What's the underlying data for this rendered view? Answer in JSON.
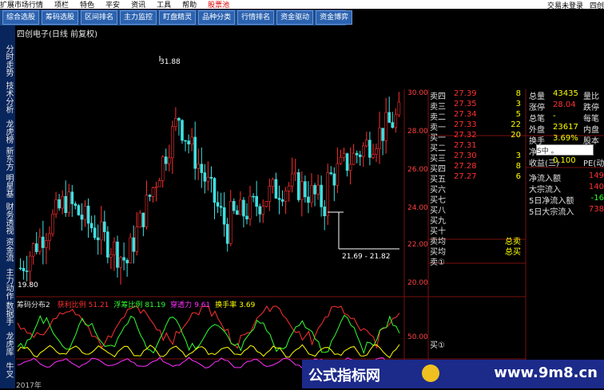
{
  "menubar": {
    "items": [
      "扩展市场行情",
      "项栏",
      "特色",
      "平安",
      "资讯",
      "工具",
      "帮助"
    ],
    "stock_pool": "股票池",
    "right": [
      "交易未登录",
      "四创"
    ]
  },
  "tabs": [
    "综合选股",
    "筹码选股",
    "区间排名",
    "主力监控",
    "盯盘精灵",
    "品种分类",
    "行情排名",
    "资金驱动",
    "资金博弈"
  ],
  "sidebar": [
    "分时走势",
    "技术分析",
    "龙虎榜",
    "新东方",
    "明星基",
    "财务透视",
    "资金流",
    "主力动作",
    "数据手",
    "龙虎库",
    "牛叉"
  ],
  "chart": {
    "title": "四创电子(日线 前复权)",
    "high_marker": "31.88",
    "low_marker": "19.80",
    "range_label": "21.69 - 21.82",
    "y_ticks": [
      "30.00",
      "28.00",
      "26.00",
      "24.00",
      "22.00",
      "20.00"
    ]
  },
  "order_book": [
    {
      "label": "卖四",
      "price": "27.39",
      "vol": "8"
    },
    {
      "label": "卖三",
      "price": "27.35",
      "vol": "3"
    },
    {
      "label": "卖二",
      "price": "27.34",
      "vol": "5"
    },
    {
      "label": "卖一",
      "price": "27.33",
      "vol": "22"
    },
    {
      "label": "买一",
      "price": "27.32",
      "vol": "20"
    },
    {
      "label": "买二",
      "price": "27.31",
      "vol": ""
    },
    {
      "label": "买三",
      "price": "27.30",
      "vol": "3"
    },
    {
      "label": "买四",
      "price": "27.28",
      "vol": "8"
    },
    {
      "label": "买五",
      "price": "27.27",
      "vol": "6"
    },
    {
      "label": "买六",
      "price": "",
      "vol": ""
    },
    {
      "label": "买七",
      "price": "",
      "vol": ""
    },
    {
      "label": "买八",
      "price": "",
      "vol": ""
    },
    {
      "label": "买九",
      "price": "",
      "vol": ""
    },
    {
      "label": "买十",
      "price": "",
      "vol": ""
    },
    {
      "label": "卖均",
      "price": "",
      "vol": "总卖"
    },
    {
      "label": "买均",
      "price": "",
      "vol": "总买"
    },
    {
      "label": "卖①",
      "price": "",
      "vol": ""
    }
  ],
  "stats": [
    {
      "k": "总量",
      "v": "43435",
      "x": "量比"
    },
    {
      "k": "涨停",
      "v": "28.04",
      "x": "跌停"
    },
    {
      "k": "总笔",
      "v": "-",
      "x": "每笔"
    },
    {
      "k": "外盘",
      "v": "23617",
      "x": "内盘"
    },
    {
      "k": "换手",
      "v": "3.69%",
      "x": "股本"
    },
    {
      "k": "净",
      "v": "",
      "x": ""
    },
    {
      "k": "收益(三)",
      "v": "0.100",
      "x": "PE(动"
    }
  ],
  "flows": [
    {
      "k": "净流入额",
      "v": "149"
    },
    {
      "k": "大宗流入",
      "v": "140"
    },
    {
      "k": "5日净流入额",
      "v": "-16"
    },
    {
      "k": "5日大宗流入",
      "v": "738"
    }
  ],
  "indicator": {
    "name": "筹码分布2",
    "items": [
      {
        "k": "获利比例",
        "v": "51.21",
        "color": "#ff3030"
      },
      {
        "k": "浮筹比例",
        "v": "81.19",
        "color": "#30ff30"
      },
      {
        "k": "穿透力",
        "v": "9.61",
        "color": "#ff30ff"
      },
      {
        "k": "换手率",
        "v": "3.69",
        "color": "#ffff00"
      }
    ],
    "lower_tick": "50.00",
    "buy_label": "买①"
  },
  "footer_axis": "2017年",
  "overlay_label": "S中 。",
  "banner": {
    "text": "公式指标网",
    "site": "www.9m8.cn"
  }
}
